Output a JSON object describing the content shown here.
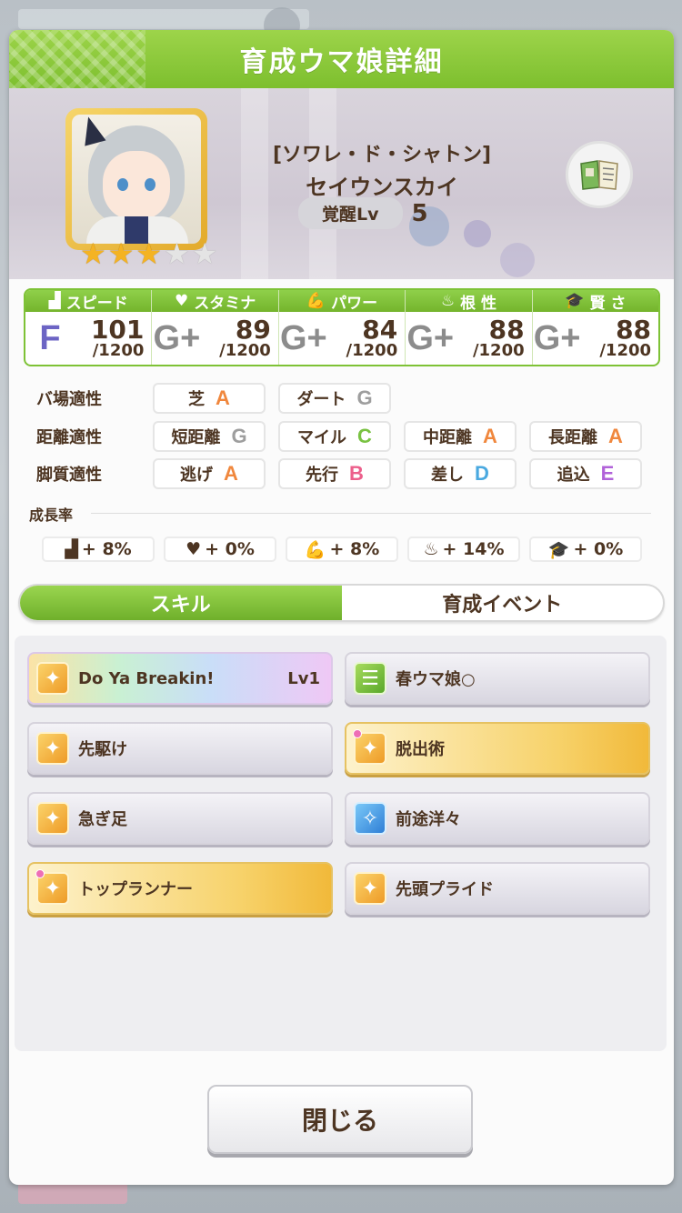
{
  "header": {
    "title": "育成ウマ娘詳細"
  },
  "character": {
    "subtitle": "[ソワレ・ド・シャトン]",
    "name": "セイウンスカイ",
    "stars_on": 3,
    "stars_total": 5,
    "awakening_label": "覚醒Lv",
    "awakening_value": "5"
  },
  "stats": [
    {
      "label": "スピード",
      "icon": "shoe-icon",
      "grade": "F",
      "value": "101",
      "max": "/1200"
    },
    {
      "label": "スタミナ",
      "icon": "heart-icon",
      "grade": "G+",
      "value": "89",
      "max": "/1200"
    },
    {
      "label": "パワー",
      "icon": "muscle-icon",
      "grade": "G+",
      "value": "84",
      "max": "/1200"
    },
    {
      "label": "根 性",
      "icon": "flame-icon",
      "grade": "G+",
      "value": "88",
      "max": "/1200"
    },
    {
      "label": "賢 さ",
      "icon": "mortarboard-icon",
      "grade": "G+",
      "value": "88",
      "max": "/1200"
    }
  ],
  "aptitude": {
    "track": {
      "label": "バ場適性",
      "items": [
        {
          "name": "芝",
          "rank": "A"
        },
        {
          "name": "ダート",
          "rank": "G"
        }
      ]
    },
    "distance": {
      "label": "距離適性",
      "items": [
        {
          "name": "短距離",
          "rank": "G"
        },
        {
          "name": "マイル",
          "rank": "C"
        },
        {
          "name": "中距離",
          "rank": "A"
        },
        {
          "name": "長距離",
          "rank": "A"
        }
      ]
    },
    "style": {
      "label": "脚質適性",
      "items": [
        {
          "name": "逃げ",
          "rank": "A"
        },
        {
          "name": "先行",
          "rank": "B"
        },
        {
          "name": "差し",
          "rank": "D"
        },
        {
          "name": "追込",
          "rank": "E"
        }
      ]
    }
  },
  "growth": {
    "title": "成長率",
    "items": [
      "+ 8%",
      "+ 0%",
      "+ 8%",
      "+ 14%",
      "+ 0%"
    ]
  },
  "tabs": {
    "skill": "スキル",
    "event": "育成イベント"
  },
  "skills": [
    {
      "name": "Do Ya Breakin!",
      "level": "Lv1",
      "style": "rainbow",
      "icon": "gold"
    },
    {
      "name": "春ウマ娘○",
      "level": "",
      "style": "normal",
      "icon": "green"
    },
    {
      "name": "先駆け",
      "level": "",
      "style": "normal",
      "icon": "gold"
    },
    {
      "name": "脱出術",
      "level": "",
      "style": "gold",
      "icon": "gold"
    },
    {
      "name": "急ぎ足",
      "level": "",
      "style": "normal",
      "icon": "gold"
    },
    {
      "name": "前途洋々",
      "level": "",
      "style": "normal",
      "icon": "blue"
    },
    {
      "name": "トップランナー",
      "level": "",
      "style": "gold",
      "icon": "gold"
    },
    {
      "name": "先頭プライド",
      "level": "",
      "style": "normal",
      "icon": "gold"
    }
  ],
  "close_button": "閉じる"
}
